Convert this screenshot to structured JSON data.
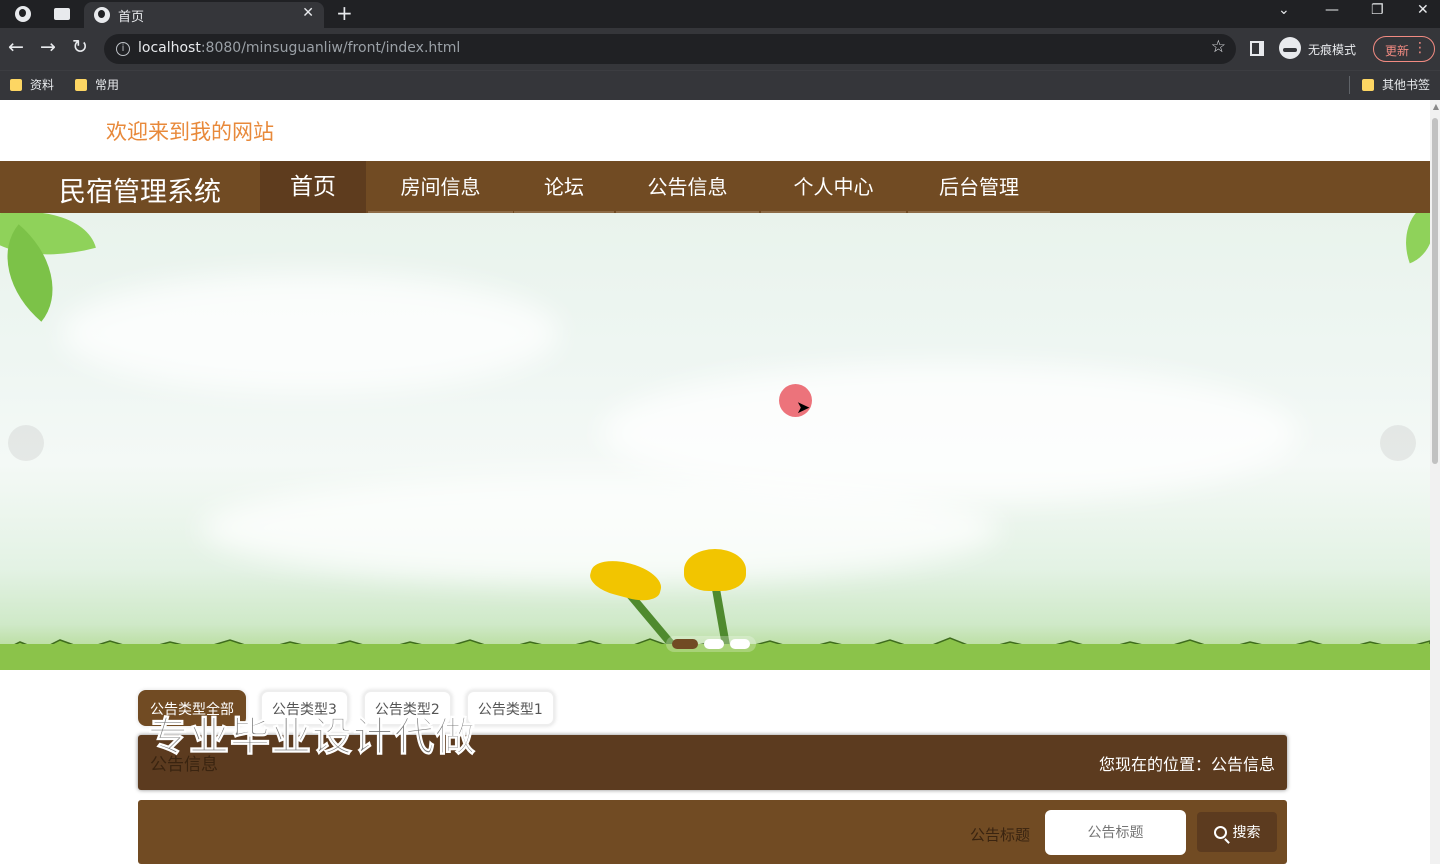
{
  "browser": {
    "tab_title": "首页",
    "url_host": "localhost",
    "url_rest": ":8080/minsuguanliw/front/index.html",
    "incognito_label": "无痕模式",
    "update_label": "更新",
    "bookmarks": [
      "资料",
      "常用"
    ],
    "other_bookmarks": "其他书签"
  },
  "site": {
    "welcome": "欢迎来到我的网站",
    "brand": "民宿管理系统",
    "nav": [
      "首页",
      "房间信息",
      "论坛",
      "公告信息",
      "个人中心",
      "后台管理"
    ],
    "active_nav": "首页"
  },
  "notice": {
    "type_tabs": [
      "公告类型全部",
      "公告类型3",
      "公告类型2",
      "公告类型1"
    ],
    "active_tab": "公告类型全部",
    "section_title": "公告信息",
    "location_label": "您现在的位置：公告信息",
    "watermark": "专业毕业设计代做",
    "search_label": "公告标题",
    "search_placeholder": "公告标题",
    "search_button": "搜索"
  },
  "carousel": {
    "slide_count": 3,
    "active_slide": 1
  }
}
